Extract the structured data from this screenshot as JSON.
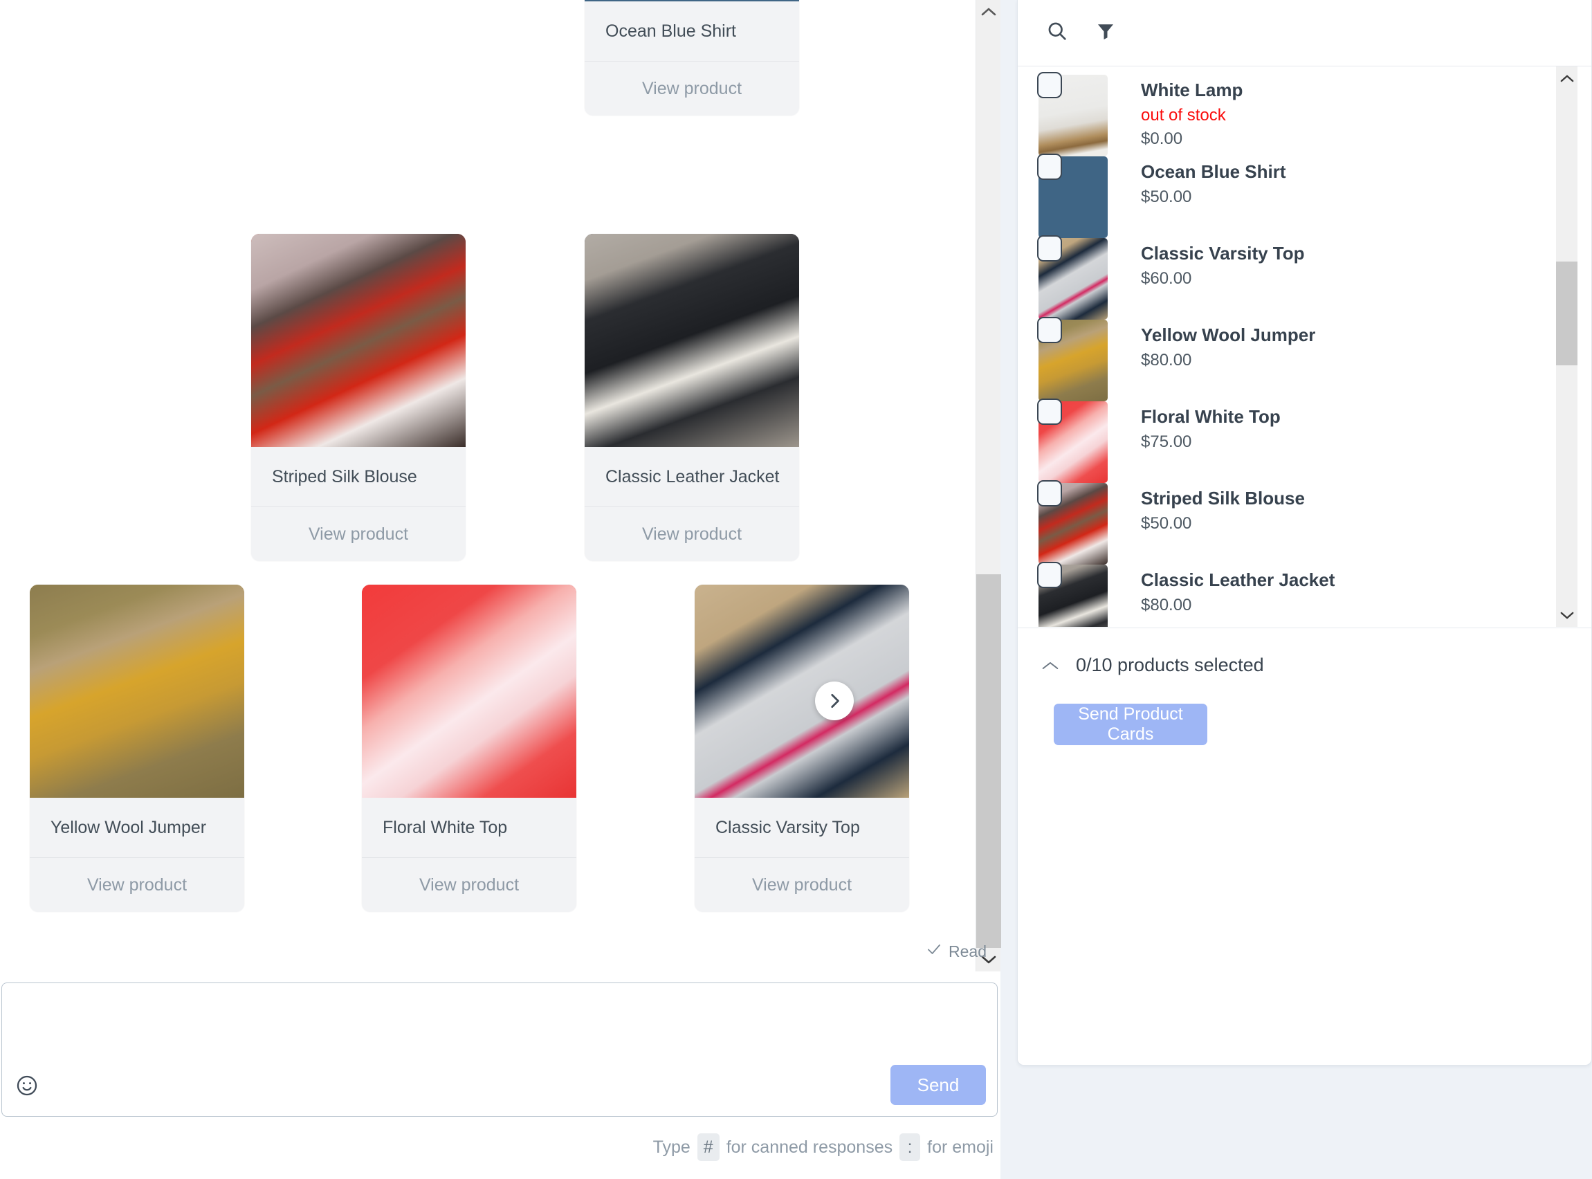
{
  "chat": {
    "read_status": "Read",
    "read_icon": "check-icon",
    "carousel_next_icon": "chevron-right-icon",
    "view_product_label": "View product",
    "cards": [
      {
        "title": "Ocean Blue Shirt",
        "action": "View product",
        "image": "ph-oceanblue"
      },
      {
        "title": "Striped Silk Blouse",
        "action": "View product",
        "image": "ph-striped"
      },
      {
        "title": "Classic Leather Jacket",
        "action": "View product",
        "image": "ph-leather"
      },
      {
        "title": "Yellow Wool Jumper",
        "action": "View product",
        "image": "ph-jumper"
      },
      {
        "title": "Floral White Top",
        "action": "View product",
        "image": "ph-floral"
      },
      {
        "title": "Classic Varsity Top",
        "action": "View product",
        "image": "ph-varsity"
      }
    ]
  },
  "composer": {
    "input_value": "",
    "input_placeholder": "",
    "emoji_icon": "smiley-face-icon",
    "send_label": "Send",
    "hint_prefix": "Type",
    "hint_key_hash": "#",
    "hint_mid": "for canned responses",
    "hint_key_colon": ":",
    "hint_suffix": "for emoji"
  },
  "picker": {
    "search_icon": "search-icon",
    "filter_icon": "filter-icon",
    "collapse_icon": "chevron-up-icon",
    "selection_text": "0/10 products selected",
    "send_cards_label": "Send Product Cards",
    "accent_color": "#9eb6f5",
    "out_of_stock_color": "#fa0c0c",
    "products": [
      {
        "name": "White Lamp",
        "stock": "out of stock",
        "price": "$0.00",
        "image": "ph-lamp"
      },
      {
        "name": "Ocean Blue Shirt",
        "stock": "",
        "price": "$50.00",
        "image": "ph-oceanblue"
      },
      {
        "name": "Classic Varsity Top",
        "stock": "",
        "price": "$60.00",
        "image": "ph-varsity"
      },
      {
        "name": "Yellow Wool Jumper",
        "stock": "",
        "price": "$80.00",
        "image": "ph-jumper"
      },
      {
        "name": "Floral White Top",
        "stock": "",
        "price": "$75.00",
        "image": "ph-floral"
      },
      {
        "name": "Striped Silk Blouse",
        "stock": "",
        "price": "$50.00",
        "image": "ph-striped"
      },
      {
        "name": "Classic Leather Jacket",
        "stock": "",
        "price": "$80.00",
        "image": "ph-leather"
      }
    ]
  }
}
